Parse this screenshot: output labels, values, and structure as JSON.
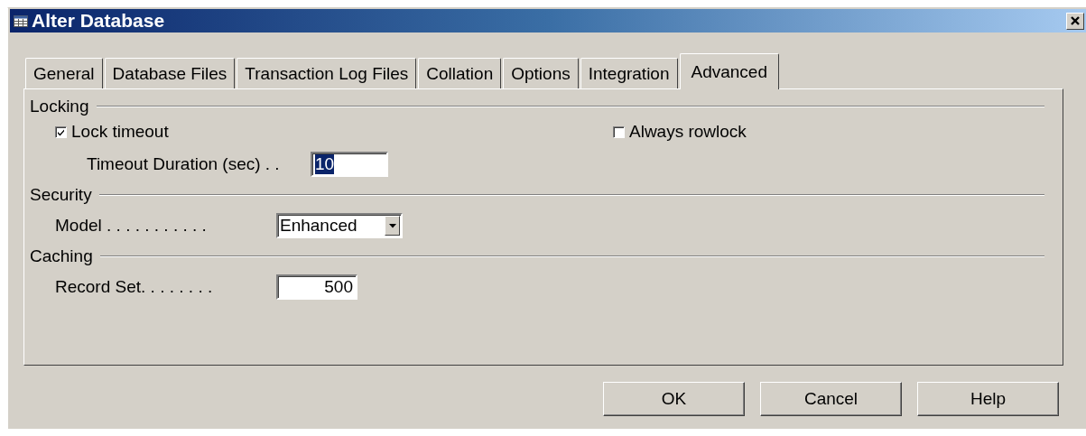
{
  "window": {
    "title": "Alter Database"
  },
  "tabs": [
    {
      "label": "General",
      "selected": false
    },
    {
      "label": "Database Files",
      "selected": false
    },
    {
      "label": "Transaction Log Files",
      "selected": false
    },
    {
      "label": "Collation",
      "selected": false
    },
    {
      "label": "Options",
      "selected": false
    },
    {
      "label": "Integration",
      "selected": false
    },
    {
      "label": "Advanced",
      "selected": true
    }
  ],
  "sections": [
    {
      "title": "Locking",
      "rows": [
        {
          "items": [
            {
              "kind": "checkbox",
              "label": "Lock timeout",
              "checked": true,
              "children": [
                {
                  "kind": "textfield",
                  "label": "Timeout Duration (sec) . .",
                  "value": "10",
                  "text_selected": true
                }
              ]
            },
            {
              "kind": "checkbox",
              "label": "Always rowlock",
              "checked": false
            }
          ]
        }
      ]
    },
    {
      "title": "Security",
      "rows": [
        {
          "items": [
            {
              "kind": "dropdown",
              "label": "Model . . . . . . . . . . .",
              "value": "Enhanced"
            }
          ]
        }
      ]
    },
    {
      "title": "Caching",
      "rows": [
        {
          "items": [
            {
              "kind": "number",
              "label": "Record Set. . . . . . . .",
              "value": "500"
            }
          ]
        }
      ]
    }
  ],
  "buttons": [
    "OK",
    "Cancel",
    "Help"
  ]
}
